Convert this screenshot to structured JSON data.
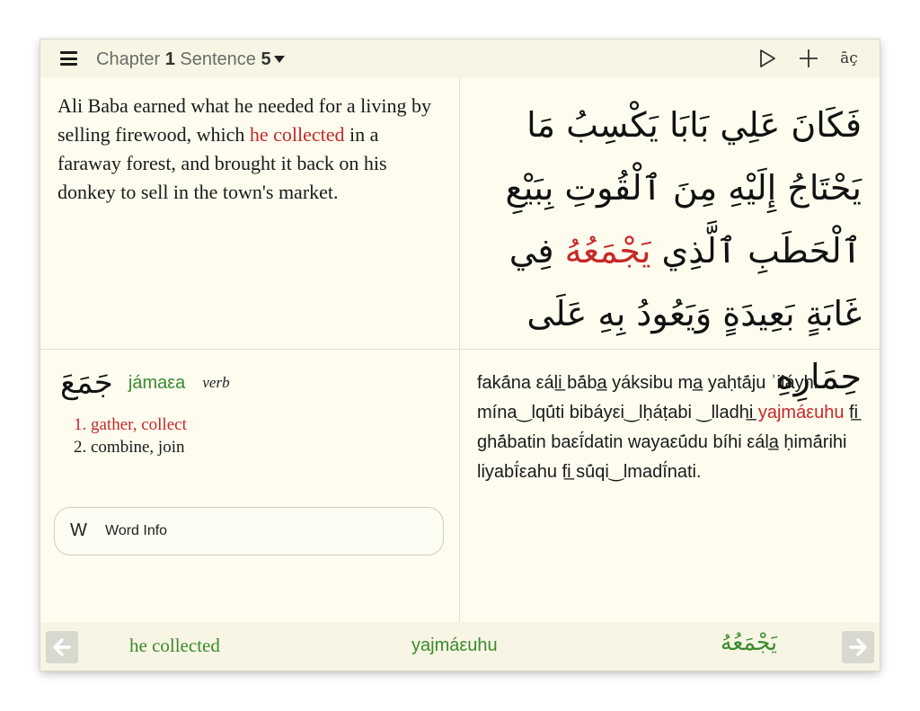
{
  "toolbar": {
    "chapter_label": "Chapter",
    "chapter_number": "1",
    "sentence_label": "Sentence",
    "sentence_number": "5",
    "icons": {
      "menu": "hamburger-menu-icon",
      "play": "play-icon",
      "add": "plus-icon",
      "transliteration": "transliteration-icon"
    },
    "transliteration_glyph": "āç"
  },
  "english": {
    "before": "Ali Baba earned what he needed for a living by selling firewood, which ",
    "highlight": "he collected",
    "after": " in a faraway forest, and brought it back on his donkey to sell in the town's market."
  },
  "arabic": {
    "before": "فَكَانَ عَلِي بَابَا يَكْسِبُ مَا يَحْتَاجُ إِلَيْهِ مِنَ ٱلْقُوتِ بِبَيْعِ ٱلْحَطَبِ ٱلَّذِي ",
    "highlight": "يَجْمَعُهُ",
    "after": " فِي غَابَةٍ بَعِيدَةٍ وَيَعُودُ بِهِ عَلَى حِمَارِهِ"
  },
  "word": {
    "arabic": "جَمَعَ",
    "transliteration": "jámaεa",
    "pos": "verb",
    "meanings": [
      "1. gather, collect",
      "2. combine, join"
    ]
  },
  "word_info": {
    "letter": "W",
    "label": "Word Info"
  },
  "transliteration": {
    "before": "fakā́na εáli̲ bā́ba̲ yáksibu ma̲ yaḥtā́ju ʾiláyhi mína‿lqū́ti bibáyεi‿lḥáṭabi ‿lladhi̲ ",
    "highlight": "yajmáεuhu",
    "after": " fi̲ ghā́batin baεī́datin wayaεū́du bíhi εála̲ ḥimā́rihi liyabī́εahu fi̲ sū́qi‿lmadī́nati."
  },
  "bottom": {
    "english": "he collected",
    "transliteration": "yajmáεuhu",
    "arabic": "يَجْمَعُهُ",
    "icons": {
      "prev": "arrow-left-icon",
      "next": "arrow-right-icon"
    }
  },
  "colors": {
    "background": "#fdfcef",
    "toolbar": "#f7f5e3",
    "highlight": "#c62828",
    "accent_green": "#3a8a2e"
  }
}
